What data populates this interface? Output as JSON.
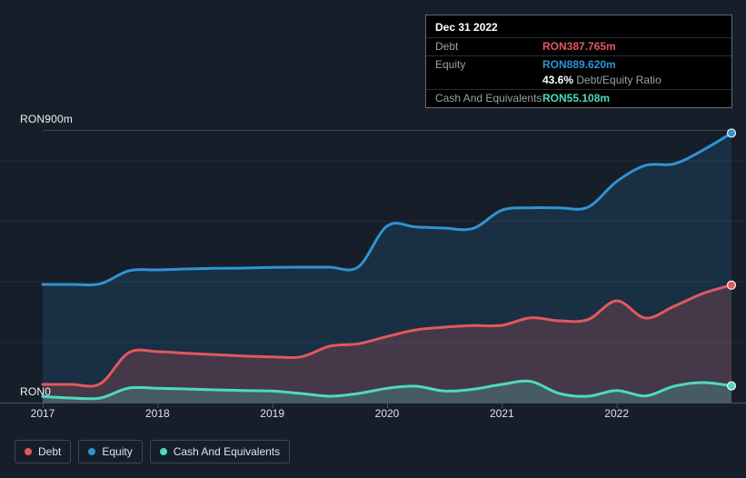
{
  "colors": {
    "background": "#161E2A",
    "debt": "#E0595E",
    "equity": "#2F93D6",
    "cash": "#4FD9BE",
    "debt_fill": "rgba(224,89,94,0.22)",
    "equity_fill": "rgba(47,147,214,0.15)",
    "cash_fill": "rgba(79,217,190,0.22)",
    "grid": "#222D3A",
    "grid_top": "#3A4553",
    "axis_line": "#49545F",
    "tick": "#4A5560",
    "text_muted": "#9AA1A8",
    "text_light": "#DFE4E9",
    "text_white": "#FFFFFF"
  },
  "tooltip": {
    "date": "Dec 31 2022",
    "debt_label": "Debt",
    "debt_value": "RON387.765m",
    "equity_label": "Equity",
    "equity_value": "RON889.620m",
    "ratio_value": "43.6%",
    "ratio_label": "Debt/Equity Ratio",
    "cash_label": "Cash And Equivalents",
    "cash_value": "RON55.108m"
  },
  "axis": {
    "y_top_label": "RON900m",
    "y_zero_label": "RON0",
    "x_labels": [
      "2017",
      "2018",
      "2019",
      "2020",
      "2021",
      "2022"
    ]
  },
  "legend": {
    "items": [
      {
        "label": "Debt",
        "color_key": "debt"
      },
      {
        "label": "Equity",
        "color_key": "equity"
      },
      {
        "label": "Cash And Equivalents",
        "color_key": "cash"
      }
    ]
  },
  "chart_data": {
    "type": "area",
    "title": "",
    "xlabel": "",
    "ylabel": "RON millions",
    "xlim": [
      2017,
      2023
    ],
    "ylim": [
      0,
      900
    ],
    "grid": true,
    "y_gridlines": [
      200,
      400,
      600,
      800
    ],
    "y_top_gridline": 900,
    "x_ticks": [
      2017,
      2018,
      2019,
      2020,
      2021,
      2022
    ],
    "legend_position": "bottom-left",
    "x": [
      2017.0,
      2017.25,
      2017.5,
      2017.75,
      2018.0,
      2018.25,
      2018.5,
      2018.75,
      2019.0,
      2019.25,
      2019.5,
      2019.75,
      2020.0,
      2020.25,
      2020.5,
      2020.75,
      2021.0,
      2021.25,
      2021.5,
      2021.75,
      2022.0,
      2022.25,
      2022.5,
      2022.75,
      2023.0
    ],
    "series": [
      {
        "name": "Debt",
        "color_key": "debt",
        "fill_key": "debt_fill",
        "values": [
          60,
          60,
          62,
          165,
          168,
          163,
          158,
          154,
          151,
          151,
          186,
          194,
          218,
          240,
          249,
          254,
          255,
          280,
          270,
          274,
          336,
          279,
          318,
          360,
          387.765
        ]
      },
      {
        "name": "Equity",
        "color_key": "equity",
        "fill_key": "equity_fill",
        "values": [
          390,
          390,
          392,
          435,
          438,
          441,
          443,
          444,
          446,
          447,
          447,
          448,
          583,
          580,
          576,
          575,
          635,
          643,
          643,
          645,
          730,
          783,
          788,
          833,
          889.62
        ]
      },
      {
        "name": "Cash And Equivalents",
        "color_key": "cash",
        "fill_key": "cash_fill",
        "values": [
          20,
          15,
          15,
          48,
          47,
          45,
          42,
          40,
          38,
          30,
          21,
          30,
          47,
          54,
          38,
          44,
          60,
          70,
          30,
          21,
          40,
          22,
          54,
          66,
          55.108
        ]
      }
    ]
  }
}
